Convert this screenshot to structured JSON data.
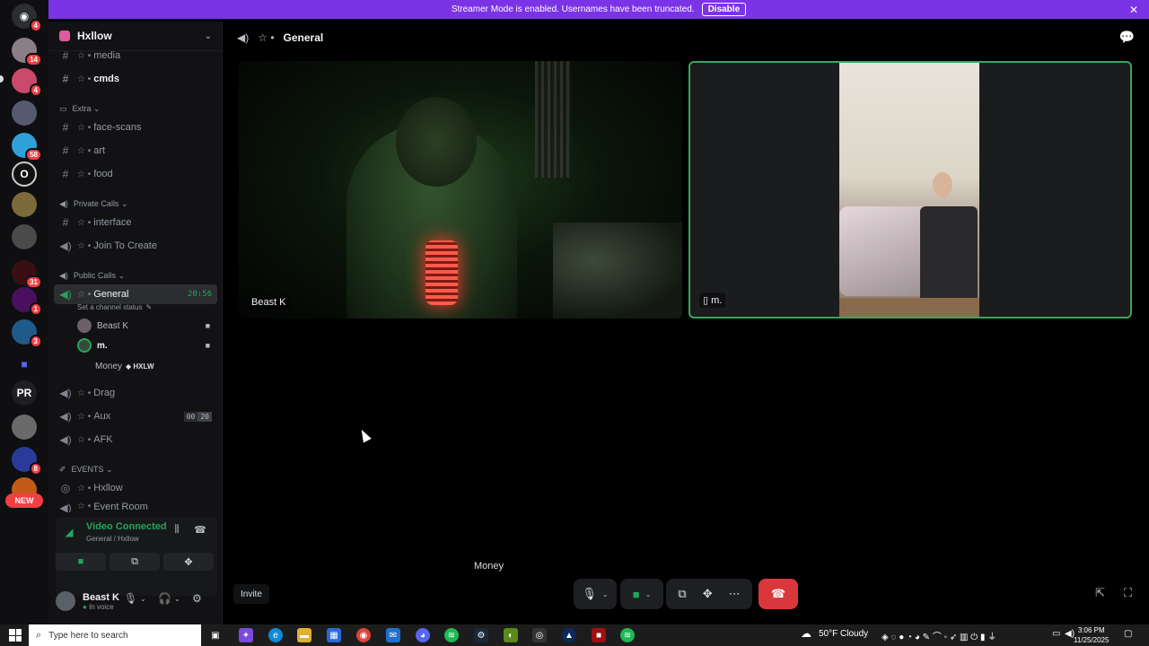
{
  "banner": {
    "text": "Streamer Mode is enabled. Usernames have been truncated.",
    "button": "Disable"
  },
  "rail": {
    "badges": [
      "4",
      "14",
      "4",
      "58",
      "31",
      "1",
      "3",
      "8"
    ],
    "pr_label": "PR",
    "new_label": "NEW"
  },
  "guild": {
    "name": "Hxllow"
  },
  "channels": {
    "media": "media",
    "cmds": "cmds",
    "cat_extra": "Extra",
    "face_scans": "face-scans",
    "art": "art",
    "food": "food",
    "cat_private": "Private Calls",
    "interface": "interface",
    "join_to_create": "Join To Create",
    "cat_public": "Public Calls",
    "general": "General",
    "general_timer": "20:56",
    "status_placeholder": "Set a channel status",
    "drag": "Drag",
    "aux": "Aux",
    "aux_count_a": "00",
    "aux_count_b": "20",
    "afk": "AFK",
    "cat_events": "EVENTS",
    "hxllow_event": "Hxllow",
    "event_room": "Event Room"
  },
  "voice_users": [
    {
      "name": "Beast K"
    },
    {
      "name": "m."
    },
    {
      "name": "Money",
      "tag": "HXLW"
    }
  ],
  "voice_panel": {
    "title": "Video Connected",
    "subtitle": "General / Hxllow"
  },
  "user": {
    "name": "Beast K",
    "status": "In voice"
  },
  "call": {
    "channel": "General",
    "tile1_name": "Beast K",
    "tile2_name": "m.",
    "screen_user": "Money",
    "invite": "Invite"
  },
  "taskbar": {
    "search_placeholder": "Type here to search",
    "weather": "50°F  Cloudy",
    "time": "3:06 PM",
    "date": "11/25/2025"
  },
  "colors": {
    "banner": "#7b33e6",
    "connected": "#23a55a",
    "end_call": "#da373c",
    "badge": "#f23f43"
  }
}
